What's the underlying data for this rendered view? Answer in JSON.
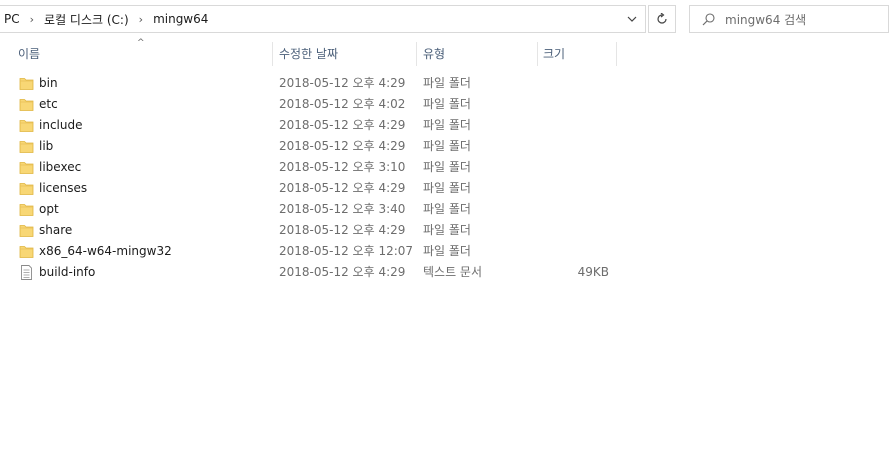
{
  "address": {
    "crumbs": [
      "PC",
      "로컬 디스크 (C:)",
      "mingw64"
    ],
    "separator": "›"
  },
  "search": {
    "placeholder": "mingw64 검색"
  },
  "columns": {
    "name": "이름",
    "date": "수정한 날짜",
    "type": "유형",
    "size": "크기"
  },
  "files": [
    {
      "name": "bin",
      "date": "2018-05-12 오후 4:29",
      "type": "파일 폴더",
      "size": "",
      "icon": "folder-icon"
    },
    {
      "name": "etc",
      "date": "2018-05-12 오후 4:02",
      "type": "파일 폴더",
      "size": "",
      "icon": "folder-icon"
    },
    {
      "name": "include",
      "date": "2018-05-12 오후 4:29",
      "type": "파일 폴더",
      "size": "",
      "icon": "folder-icon"
    },
    {
      "name": "lib",
      "date": "2018-05-12 오후 4:29",
      "type": "파일 폴더",
      "size": "",
      "icon": "folder-icon"
    },
    {
      "name": "libexec",
      "date": "2018-05-12 오후 3:10",
      "type": "파일 폴더",
      "size": "",
      "icon": "folder-icon"
    },
    {
      "name": "licenses",
      "date": "2018-05-12 오후 4:29",
      "type": "파일 폴더",
      "size": "",
      "icon": "folder-icon"
    },
    {
      "name": "opt",
      "date": "2018-05-12 오후 3:40",
      "type": "파일 폴더",
      "size": "",
      "icon": "folder-icon"
    },
    {
      "name": "share",
      "date": "2018-05-12 오후 4:29",
      "type": "파일 폴더",
      "size": "",
      "icon": "folder-icon"
    },
    {
      "name": "x86_64-w64-mingw32",
      "date": "2018-05-12 오후 12:07",
      "type": "파일 폴더",
      "size": "",
      "icon": "folder-icon"
    },
    {
      "name": "build-info",
      "date": "2018-05-12 오후 4:29",
      "type": "텍스트 문서",
      "size": "49KB",
      "icon": "text-file-icon"
    }
  ],
  "colors": {
    "folder": "#f8d775",
    "header_text": "#4c607a",
    "secondary_text": "#6d6d6d"
  }
}
